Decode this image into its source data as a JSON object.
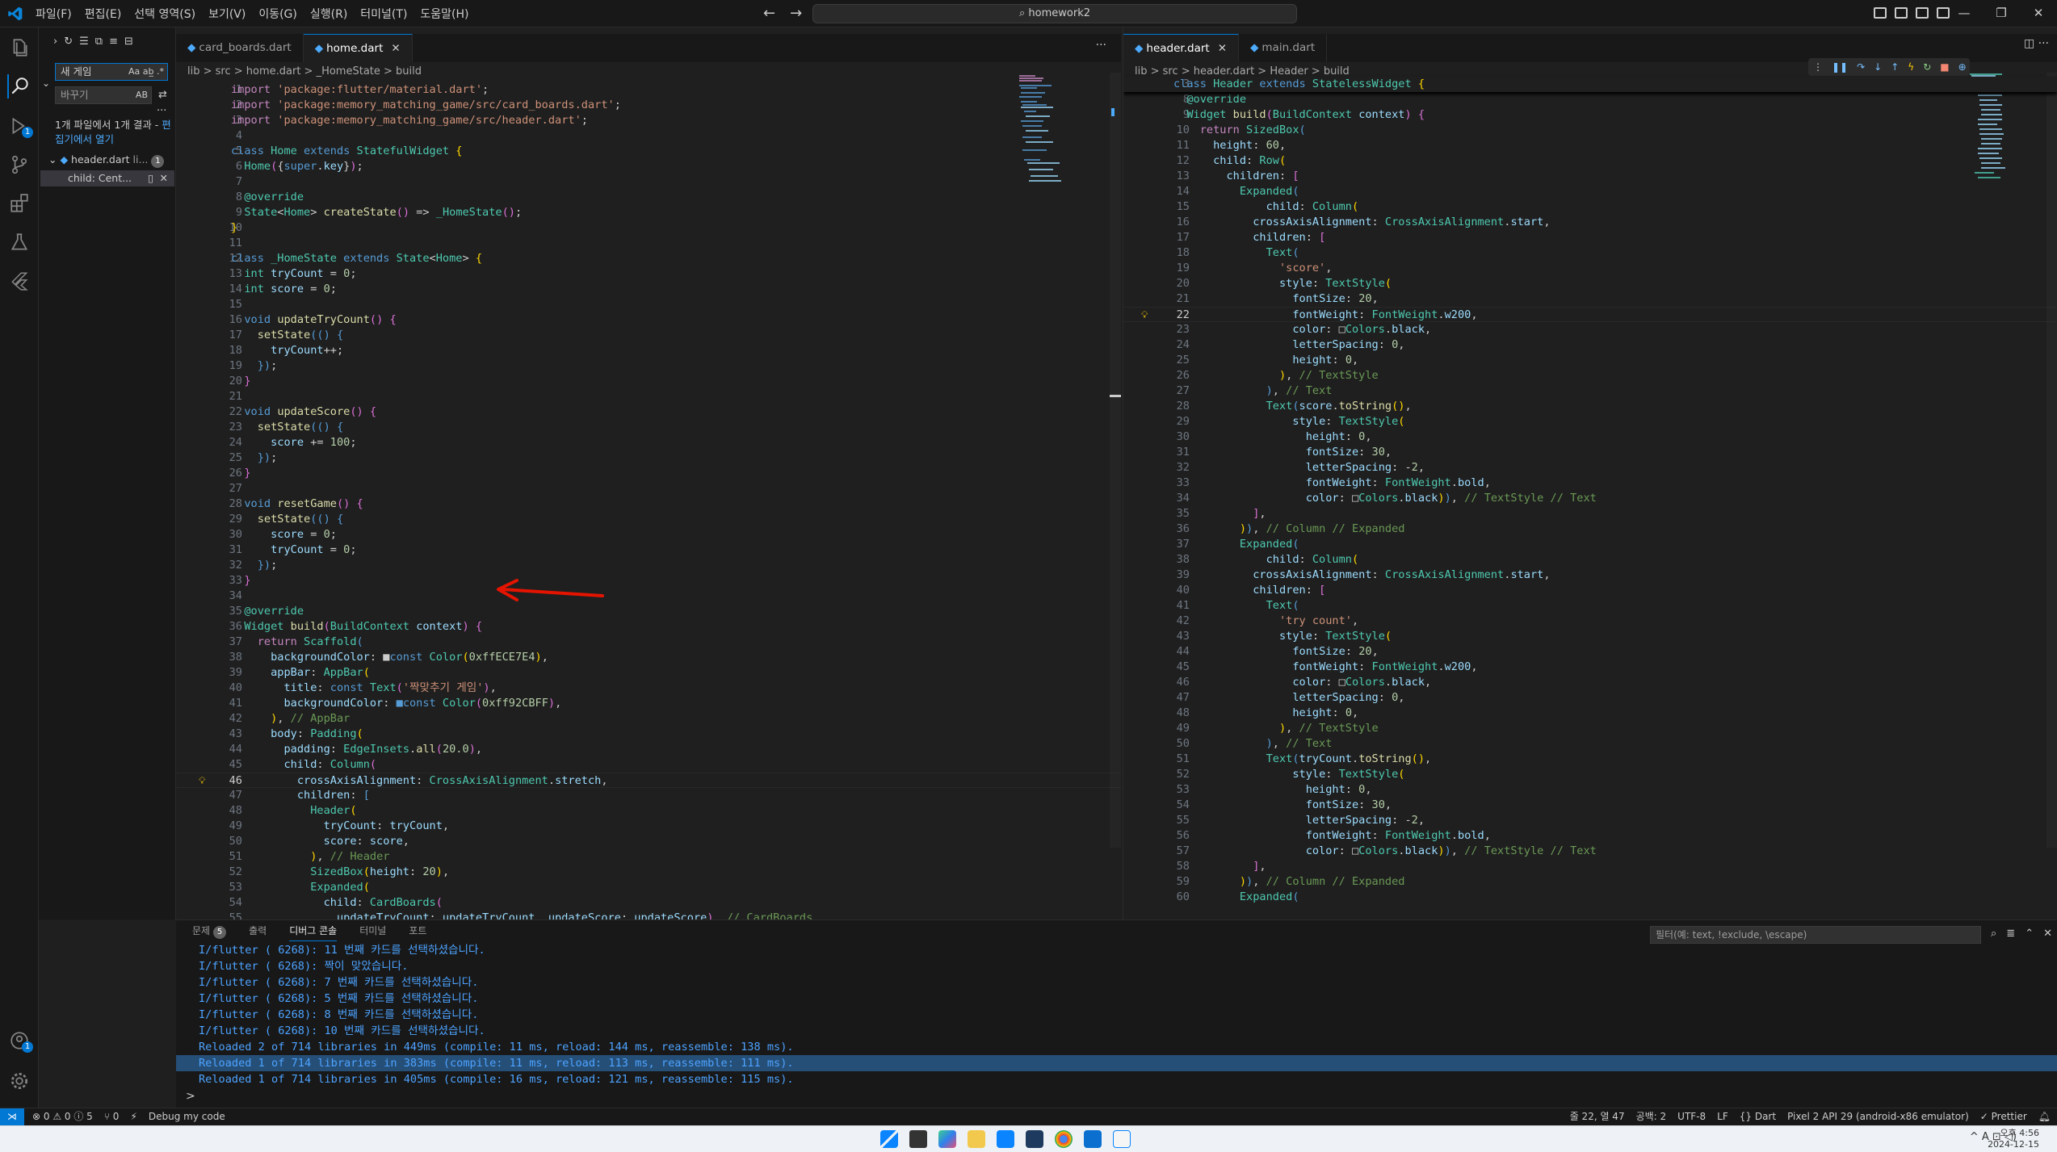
{
  "titlebar": {
    "menu": [
      "파일(F)",
      "편집(E)",
      "선택 영역(S)",
      "보기(V)",
      "이동(G)",
      "실행(R)",
      "터미널(T)",
      "도움말(H)"
    ],
    "search": "homework2"
  },
  "sidebar": {
    "search_value": "새 게임",
    "search_opts": "Aa ab̲ .*",
    "replace_placeholder": "바꾸기",
    "replace_opt": "AB",
    "result_text": "1개 파일에서 1개 결과 - ",
    "result_link": "편집기에서 열기",
    "file_name": "header.dart",
    "file_path": "li...",
    "file_count": "1",
    "match_text": "child: Cent..."
  },
  "left_editor": {
    "tabs": [
      {
        "name": "card_boards.dart",
        "active": false
      },
      {
        "name": "home.dart",
        "active": true
      }
    ],
    "breadcrumb": "lib > src > home.dart > _HomeState > build",
    "current_line": 46,
    "lines": [
      {
        "n": 1,
        "h": "<span class='c'>import</span> <span class='s'>'package:flutter/material.dart'</span>;"
      },
      {
        "n": 2,
        "h": "<span class='c'>import</span> <span class='s'>'package:memory_matching_game/src/card_boards.dart'</span>;"
      },
      {
        "n": 3,
        "h": "<span class='c'>import</span> <span class='s'>'package:memory_matching_game/src/header.dart'</span>;"
      },
      {
        "n": 4,
        "h": ""
      },
      {
        "n": 5,
        "h": "<span class='k'>class</span> <span class='t'>Home</span> <span class='k'>extends</span> <span class='t'>StatefulWidget</span> <span class='yb'>{</span>"
      },
      {
        "n": 6,
        "h": "  <span class='t'>Home</span><span class='pk'>(</span>{<span class='k'>super</span>.<span class='v'>key</span>}<span class='pk'>)</span>;"
      },
      {
        "n": 7,
        "h": ""
      },
      {
        "n": 8,
        "h": "  <span class='t'>@override</span>"
      },
      {
        "n": 9,
        "h": "  <span class='t'>State</span>&lt;<span class='t'>Home</span>&gt; <span class='f'>createState</span><span class='pk'>()</span> =&gt; <span class='t'>_HomeState</span><span class='pk'>()</span>;"
      },
      {
        "n": 10,
        "h": "<span class='yb'>}</span>"
      },
      {
        "n": 11,
        "h": ""
      },
      {
        "n": 12,
        "h": "<span class='k'>class</span> <span class='t'>_HomeState</span> <span class='k'>extends</span> <span class='t'>State</span>&lt;<span class='t'>Home</span>&gt; <span class='yb'>{</span>"
      },
      {
        "n": 13,
        "h": "  <span class='t'>int</span> <span class='v'>tryCount</span> = <span class='n'>0</span>;"
      },
      {
        "n": 14,
        "h": "  <span class='t'>int</span> <span class='v'>score</span> = <span class='n'>0</span>;"
      },
      {
        "n": 15,
        "h": ""
      },
      {
        "n": 16,
        "h": "  <span class='k'>void</span> <span class='f'>updateTryCount</span><span class='pk'>()</span> <span class='pk'>{</span>"
      },
      {
        "n": 17,
        "h": "    <span class='f'>setState</span><span class='k'>(()</span> <span class='k'>{</span>"
      },
      {
        "n": 18,
        "h": "      <span class='v'>tryCount</span>++;"
      },
      {
        "n": 19,
        "h": "    <span class='k'>})</span>;"
      },
      {
        "n": 20,
        "h": "  <span class='pk'>}</span>"
      },
      {
        "n": 21,
        "h": ""
      },
      {
        "n": 22,
        "h": "  <span class='k'>void</span> <span class='f'>updateScore</span><span class='pk'>()</span> <span class='pk'>{</span>"
      },
      {
        "n": 23,
        "h": "    <span class='f'>setState</span><span class='k'>(()</span> <span class='k'>{</span>"
      },
      {
        "n": 24,
        "h": "      <span class='v'>score</span> += <span class='n'>100</span>;"
      },
      {
        "n": 25,
        "h": "    <span class='k'>})</span>;"
      },
      {
        "n": 26,
        "h": "  <span class='pk'>}</span>"
      },
      {
        "n": 27,
        "h": ""
      },
      {
        "n": 28,
        "h": "  <span class='k'>void</span> <span class='f'>resetGame</span><span class='pk'>()</span> <span class='pk'>{</span>"
      },
      {
        "n": 29,
        "h": "    <span class='f'>setState</span><span class='k'>(()</span> <span class='k'>{</span>"
      },
      {
        "n": 30,
        "h": "      <span class='v'>score</span> = <span class='n'>0</span>;"
      },
      {
        "n": 31,
        "h": "      <span class='v'>tryCount</span> = <span class='n'>0</span>;"
      },
      {
        "n": 32,
        "h": "    <span class='k'>})</span>;"
      },
      {
        "n": 33,
        "h": "  <span class='pk'>}</span>"
      },
      {
        "n": 34,
        "h": ""
      },
      {
        "n": 35,
        "h": "  <span class='t'>@override</span>"
      },
      {
        "n": 36,
        "h": "  <span class='t'>Widget</span> <span class='f'>build</span><span class='pk'>(</span><span class='t'>BuildContext</span> <span class='v'>context</span><span class='pk'>)</span> <span class='pk'>{</span>"
      },
      {
        "n": 37,
        "h": "    <span class='c'>return</span> <span class='t'>Scaffold</span><span class='k'>(</span>"
      },
      {
        "n": 38,
        "h": "      <span class='v'>backgroundColor</span>: <span class='g'>■</span><span class='k'>const</span> <span class='t'>Color</span><span class='yb'>(</span><span class='n'>0xffECE7E4</span><span class='yb'>)</span>,"
      },
      {
        "n": 39,
        "h": "      <span class='v'>appBar</span>: <span class='t'>AppBar</span><span class='yb'>(</span>"
      },
      {
        "n": 40,
        "h": "        <span class='v'>title</span>: <span class='k'>const</span> <span class='t'>Text</span><span class='pk'>(</span><span class='s'>'짝맞추기 게임'</span><span class='pk'>)</span>,"
      },
      {
        "n": 41,
        "h": "        <span class='v'>backgroundColor</span>: <span class='k'>■</span><span class='k'>const</span> <span class='t'>Color</span><span class='pk'>(</span><span class='n'>0xff92CBFF</span><span class='pk'>)</span>,"
      },
      {
        "n": 42,
        "h": "      <span class='yb'>)</span>, <span class='cm'>// AppBar</span>"
      },
      {
        "n": 43,
        "h": "      <span class='v'>body</span>: <span class='t'>Padding</span><span class='yb'>(</span>"
      },
      {
        "n": 44,
        "h": "        <span class='v'>padding</span>: <span class='t'>EdgeInsets</span>.<span class='f'>all</span><span class='pk'>(</span><span class='n'>20.0</span><span class='pk'>)</span>,"
      },
      {
        "n": 45,
        "h": "        <span class='v'>child</span>: <span class='t'>Column</span><span class='pk'>(</span>"
      },
      {
        "n": 46,
        "h": "          <span class='v'>crossAxisAlignment</span>: <span class='t'>CrossAxisAlignment</span>.<span class='v'>stretch</span>,"
      },
      {
        "n": 47,
        "h": "          <span class='v'>children</span>: <span class='k'>[</span>"
      },
      {
        "n": 48,
        "h": "            <span class='t'>Header</span><span class='yb'>(</span>"
      },
      {
        "n": 49,
        "h": "              <span class='v'>tryCount</span>: <span class='v'>tryCount</span>,"
      },
      {
        "n": 50,
        "h": "              <span class='v'>score</span>: <span class='v'>score</span>,"
      },
      {
        "n": 51,
        "h": "            <span class='yb'>)</span>, <span class='cm'>// Header</span>"
      },
      {
        "n": 52,
        "h": "            <span class='t'>SizedBox</span><span class='yb'>(</span><span class='v'>height</span>: <span class='n'>20</span><span class='yb'>)</span>,"
      },
      {
        "n": 53,
        "h": "            <span class='t'>Expanded</span><span class='yb'>(</span>"
      },
      {
        "n": 54,
        "h": "              <span class='v'>child</span>: <span class='t'>CardBoards</span><span class='pk'>(</span>"
      },
      {
        "n": 55,
        "h": "                <span class='v'>updateTryCount</span>: <span class='v'>updateTryCount</span>, <span class='v'>updateScore</span>: <span class='v'>updateScore</span><span class='pk'>)</span>, <span class='cm'>// CardBoards</span>"
      }
    ]
  },
  "right_editor": {
    "tabs": [
      {
        "name": "header.dart",
        "active": true
      },
      {
        "name": "main.dart",
        "active": false
      }
    ],
    "breadcrumb": "lib > src > header.dart > Header > build",
    "sticky": {
      "n": 3,
      "h": "<span class='k'>class</span> <span class='t'>Header</span> <span class='k'>extends</span> <span class='t'>StatelessWidget</span> <span class='yb'>{</span>"
    },
    "current_line": 22,
    "lines": [
      {
        "n": 8,
        "h": "  <span class='t'>@override</span>"
      },
      {
        "n": 9,
        "h": "  <span class='t'>Widget</span> <span class='f'>build</span><span class='pk'>(</span><span class='t'>BuildContext</span> <span class='v'>context</span><span class='pk'>)</span> <span class='pk'>{</span>"
      },
      {
        "n": 10,
        "h": "    <span class='c'>return</span> <span class='t'>SizedBox</span><span class='k'>(</span>"
      },
      {
        "n": 11,
        "h": "      <span class='v'>height</span>: <span class='n'>60</span>,"
      },
      {
        "n": 12,
        "h": "      <span class='v'>child</span>: <span class='t'>Row</span><span class='yb'>(</span>"
      },
      {
        "n": 13,
        "h": "        <span class='v'>children</span>: <span class='pk'>[</span>"
      },
      {
        "n": 14,
        "h": "          <span class='t'>Expanded</span><span class='k'>(</span>"
      },
      {
        "n": 15,
        "h": "              <span class='v'>child</span>: <span class='t'>Column</span><span class='yb'>(</span>"
      },
      {
        "n": 16,
        "h": "            <span class='v'>crossAxisAlignment</span>: <span class='t'>CrossAxisAlignment</span>.<span class='v'>start</span>,"
      },
      {
        "n": 17,
        "h": "            <span class='v'>children</span>: <span class='pk'>[</span>"
      },
      {
        "n": 18,
        "h": "              <span class='t'>Text</span><span class='k'>(</span>"
      },
      {
        "n": 19,
        "h": "                <span class='s'>'score'</span>,"
      },
      {
        "n": 20,
        "h": "                <span class='v'>style</span>: <span class='t'>TextStyle</span><span class='yb'>(</span>"
      },
      {
        "n": 21,
        "h": "                  <span class='v'>fontSize</span>: <span class='n'>20</span>,"
      },
      {
        "n": 22,
        "h": "                  <span class='v'>fontWeight</span>: <span class='t'>FontWeight</span>.<span class='v'>w200</span>,"
      },
      {
        "n": 23,
        "h": "                  <span class='v'>color</span>: <span class='g'>□</span><span class='t'>Colors</span>.<span class='v'>black</span>,"
      },
      {
        "n": 24,
        "h": "                  <span class='v'>letterSpacing</span>: <span class='n'>0</span>,"
      },
      {
        "n": 25,
        "h": "                  <span class='v'>height</span>: <span class='n'>0</span>,"
      },
      {
        "n": 26,
        "h": "                <span class='yb'>)</span>, <span class='cm'>// TextStyle</span>"
      },
      {
        "n": 27,
        "h": "              <span class='k'>)</span>, <span class='cm'>// Text</span>"
      },
      {
        "n": 28,
        "h": "              <span class='t'>Text</span><span class='k'>(</span><span class='v'>score</span>.<span class='f'>toString</span><span class='yb'>()</span>,"
      },
      {
        "n": 29,
        "h": "                  <span class='v'>style</span>: <span class='t'>TextStyle</span><span class='yb'>(</span>"
      },
      {
        "n": 30,
        "h": "                    <span class='v'>height</span>: <span class='n'>0</span>,"
      },
      {
        "n": 31,
        "h": "                    <span class='v'>fontSize</span>: <span class='n'>30</span>,"
      },
      {
        "n": 32,
        "h": "                    <span class='v'>letterSpacing</span>: -<span class='n'>2</span>,"
      },
      {
        "n": 33,
        "h": "                    <span class='v'>fontWeight</span>: <span class='t'>FontWeight</span>.<span class='v'>bold</span>,"
      },
      {
        "n": 34,
        "h": "                    <span class='v'>color</span>: <span class='g'>□</span><span class='t'>Colors</span>.<span class='v'>black</span><span class='yb'>)</span><span class='k'>)</span>, <span class='cm'>// TextStyle // Text</span>"
      },
      {
        "n": 35,
        "h": "            <span class='pk'>]</span>,"
      },
      {
        "n": 36,
        "h": "          <span class='yb'>)</span><span class='k'>)</span>, <span class='cm'>// Column // Expanded</span>"
      },
      {
        "n": 37,
        "h": "          <span class='t'>Expanded</span><span class='k'>(</span>"
      },
      {
        "n": 38,
        "h": "              <span class='v'>child</span>: <span class='t'>Column</span><span class='yb'>(</span>"
      },
      {
        "n": 39,
        "h": "            <span class='v'>crossAxisAlignment</span>: <span class='t'>CrossAxisAlignment</span>.<span class='v'>start</span>,"
      },
      {
        "n": 40,
        "h": "            <span class='v'>children</span>: <span class='pk'>[</span>"
      },
      {
        "n": 41,
        "h": "              <span class='t'>Text</span><span class='k'>(</span>"
      },
      {
        "n": 42,
        "h": "                <span class='s'>'try count'</span>,"
      },
      {
        "n": 43,
        "h": "                <span class='v'>style</span>: <span class='t'>TextStyle</span><span class='yb'>(</span>"
      },
      {
        "n": 44,
        "h": "                  <span class='v'>fontSize</span>: <span class='n'>20</span>,"
      },
      {
        "n": 45,
        "h": "                  <span class='v'>fontWeight</span>: <span class='t'>FontWeight</span>.<span class='v'>w200</span>,"
      },
      {
        "n": 46,
        "h": "                  <span class='v'>color</span>: <span class='g'>□</span><span class='t'>Colors</span>.<span class='v'>black</span>,"
      },
      {
        "n": 47,
        "h": "                  <span class='v'>letterSpacing</span>: <span class='n'>0</span>,"
      },
      {
        "n": 48,
        "h": "                  <span class='v'>height</span>: <span class='n'>0</span>,"
      },
      {
        "n": 49,
        "h": "                <span class='yb'>)</span>, <span class='cm'>// TextStyle</span>"
      },
      {
        "n": 50,
        "h": "              <span class='k'>)</span>, <span class='cm'>// Text</span>"
      },
      {
        "n": 51,
        "h": "              <span class='t'>Text</span><span class='k'>(</span><span class='v'>tryCount</span>.<span class='f'>toString</span><span class='yb'>()</span>,"
      },
      {
        "n": 52,
        "h": "                  <span class='v'>style</span>: <span class='t'>TextStyle</span><span class='yb'>(</span>"
      },
      {
        "n": 53,
        "h": "                    <span class='v'>height</span>: <span class='n'>0</span>,"
      },
      {
        "n": 54,
        "h": "                    <span class='v'>fontSize</span>: <span class='n'>30</span>,"
      },
      {
        "n": 55,
        "h": "                    <span class='v'>letterSpacing</span>: -<span class='n'>2</span>,"
      },
      {
        "n": 56,
        "h": "                    <span class='v'>fontWeight</span>: <span class='t'>FontWeight</span>.<span class='v'>bold</span>,"
      },
      {
        "n": 57,
        "h": "                    <span class='v'>color</span>: <span class='g'>□</span><span class='t'>Colors</span>.<span class='v'>black</span><span class='yb'>)</span><span class='k'>)</span>, <span class='cm'>// TextStyle // Text</span>"
      },
      {
        "n": 58,
        "h": "            <span class='pk'>]</span>,"
      },
      {
        "n": 59,
        "h": "          <span class='yb'>)</span><span class='k'>)</span>, <span class='cm'>// Column // Expanded</span>"
      },
      {
        "n": 60,
        "h": "          <span class='t'>Expanded</span><span class='k'>(</span>"
      }
    ]
  },
  "panel": {
    "tabs": [
      {
        "label": "문제",
        "count": "5",
        "active": false
      },
      {
        "label": "출력",
        "active": false
      },
      {
        "label": "디버그 콘솔",
        "active": true
      },
      {
        "label": "터미널",
        "active": false
      },
      {
        "label": "포트",
        "active": false
      }
    ],
    "filter_placeholder": "필터(예: text, !exclude, \\escape)",
    "output": [
      {
        "text": "I/flutter ( 6268): 11 번째 카드를 선택하셨습니다.",
        "hl": false
      },
      {
        "text": "I/flutter ( 6268): 짝이 맞았습니다.",
        "hl": false
      },
      {
        "text": "I/flutter ( 6268): 7 번째 카드를 선택하셨습니다.",
        "hl": false
      },
      {
        "text": "I/flutter ( 6268): 5 번째 카드를 선택하셨습니다.",
        "hl": false
      },
      {
        "text": "I/flutter ( 6268): 8 번째 카드를 선택하셨습니다.",
        "hl": false
      },
      {
        "text": "I/flutter ( 6268): 10 번째 카드를 선택하셨습니다.",
        "hl": false
      },
      {
        "text": "Reloaded 2 of 714 libraries in 449ms (compile: 11 ms, reload: 144 ms, reassemble: 138 ms).",
        "hl": false
      },
      {
        "text": "Reloaded 1 of 714 libraries in 383ms (compile: 11 ms, reload: 113 ms, reassemble: 111 ms).",
        "hl": true
      },
      {
        "text": "Reloaded 1 of 714 libraries in 405ms (compile: 16 ms, reload: 121 ms, reassemble: 115 ms).",
        "hl": false
      }
    ],
    "prompt": ">"
  },
  "statusbar": {
    "errors": "⊗ 0 ⚠ 0 ⓘ 5",
    "ports": "⑂ 0",
    "debug": "Debug my code",
    "position": "줄 22, 열 47",
    "spaces": "공백: 2",
    "encoding": "UTF-8",
    "eol": "LF",
    "language": "{} Dart",
    "device": "Pixel 2 API 29 (android-x86 emulator)",
    "prettier": "✓ Prettier"
  },
  "taskbar": {
    "time": "오후 4:56",
    "date": "2024-12-15",
    "tray": "^ A ⊡ ◁)"
  },
  "colors": {
    "accent": "#0078d4",
    "editor_bg": "#1f1f1f",
    "arrow": "#e51400"
  }
}
